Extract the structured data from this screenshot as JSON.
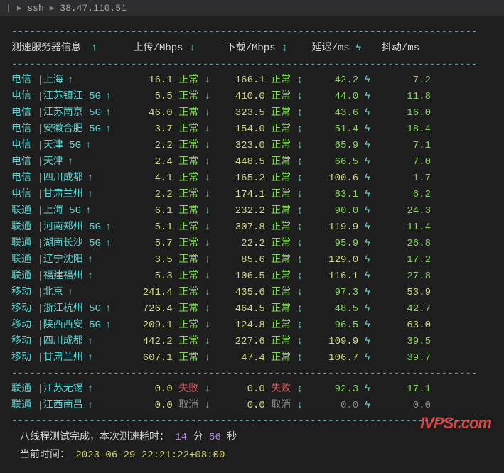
{
  "titlebar": {
    "ssh": "ssh",
    "ip": "38.47.110.51"
  },
  "headers": {
    "server": "测速服务器信息",
    "upload": "上传/Mbps",
    "download": "下载/Mbps",
    "latency": "延迟/ms",
    "jitter": "抖动/ms"
  },
  "rows": [
    {
      "isp": "电信",
      "loc": "上海",
      "up": "16.1",
      "up_st": "正常",
      "dn": "166.1",
      "dn_st": "正常",
      "lat": "42.2",
      "lat_c": "green",
      "jit": "7.2",
      "jit_c": "green"
    },
    {
      "isp": "电信",
      "loc": "江苏镇江 5G",
      "up": "5.5",
      "up_st": "正常",
      "dn": "410.0",
      "dn_st": "正常",
      "lat": "44.0",
      "lat_c": "green",
      "jit": "11.8",
      "jit_c": "green"
    },
    {
      "isp": "电信",
      "loc": "江苏南京 5G",
      "up": "46.0",
      "up_st": "正常",
      "dn": "323.5",
      "dn_st": "正常",
      "lat": "43.6",
      "lat_c": "green",
      "jit": "16.0",
      "jit_c": "green"
    },
    {
      "isp": "电信",
      "loc": "安徽合肥 5G",
      "up": "3.7",
      "up_st": "正常",
      "dn": "154.0",
      "dn_st": "正常",
      "lat": "51.4",
      "lat_c": "green",
      "jit": "18.4",
      "jit_c": "green"
    },
    {
      "isp": "电信",
      "loc": "天津 5G",
      "up": "2.2",
      "up_st": "正常",
      "dn": "323.0",
      "dn_st": "正常",
      "lat": "65.9",
      "lat_c": "green",
      "jit": "7.1",
      "jit_c": "green"
    },
    {
      "isp": "电信",
      "loc": "天津",
      "up": "2.4",
      "up_st": "正常",
      "dn": "448.5",
      "dn_st": "正常",
      "lat": "66.5",
      "lat_c": "green",
      "jit": "7.0",
      "jit_c": "green"
    },
    {
      "isp": "电信",
      "loc": "四川成都",
      "up": "4.1",
      "up_st": "正常",
      "dn": "165.2",
      "dn_st": "正常",
      "lat": "100.6",
      "lat_c": "yellow",
      "jit": "1.7",
      "jit_c": "green"
    },
    {
      "isp": "电信",
      "loc": "甘肃兰州",
      "up": "2.2",
      "up_st": "正常",
      "dn": "174.1",
      "dn_st": "正常",
      "lat": "83.1",
      "lat_c": "green",
      "jit": "6.2",
      "jit_c": "green"
    },
    {
      "isp": "联通",
      "loc": "上海 5G",
      "up": "6.1",
      "up_st": "正常",
      "dn": "232.2",
      "dn_st": "正常",
      "lat": "90.0",
      "lat_c": "green",
      "jit": "24.3",
      "jit_c": "green"
    },
    {
      "isp": "联通",
      "loc": "河南郑州 5G",
      "up": "5.1",
      "up_st": "正常",
      "dn": "307.8",
      "dn_st": "正常",
      "lat": "119.9",
      "lat_c": "yellow",
      "jit": "11.4",
      "jit_c": "green"
    },
    {
      "isp": "联通",
      "loc": "湖南长沙 5G",
      "up": "5.7",
      "up_st": "正常",
      "dn": "22.2",
      "dn_st": "正常",
      "lat": "95.9",
      "lat_c": "green",
      "jit": "26.8",
      "jit_c": "green"
    },
    {
      "isp": "联通",
      "loc": "辽宁沈阳",
      "up": "3.5",
      "up_st": "正常",
      "dn": "85.6",
      "dn_st": "正常",
      "lat": "129.0",
      "lat_c": "yellow",
      "jit": "17.2",
      "jit_c": "green"
    },
    {
      "isp": "联通",
      "loc": "福建福州",
      "up": "5.3",
      "up_st": "正常",
      "dn": "106.5",
      "dn_st": "正常",
      "lat": "116.1",
      "lat_c": "yellow",
      "jit": "27.8",
      "jit_c": "green"
    },
    {
      "isp": "移动",
      "loc": "北京",
      "up": "241.4",
      "up_st": "正常",
      "dn": "435.6",
      "dn_st": "正常",
      "lat": "97.3",
      "lat_c": "green",
      "jit": "53.9",
      "jit_c": "yellow"
    },
    {
      "isp": "移动",
      "loc": "浙江杭州 5G",
      "up": "726.4",
      "up_st": "正常",
      "dn": "464.5",
      "dn_st": "正常",
      "lat": "48.5",
      "lat_c": "green",
      "jit": "42.7",
      "jit_c": "green"
    },
    {
      "isp": "移动",
      "loc": "陕西西安 5G",
      "up": "209.1",
      "up_st": "正常",
      "dn": "124.8",
      "dn_st": "正常",
      "lat": "96.5",
      "lat_c": "green",
      "jit": "63.0",
      "jit_c": "yellow"
    },
    {
      "isp": "移动",
      "loc": "四川成都",
      "up": "442.2",
      "up_st": "正常",
      "dn": "227.6",
      "dn_st": "正常",
      "lat": "109.9",
      "lat_c": "yellow",
      "jit": "39.5",
      "jit_c": "green"
    },
    {
      "isp": "移动",
      "loc": "甘肃兰州",
      "up": "607.1",
      "up_st": "正常",
      "dn": "47.4",
      "dn_st": "正常",
      "lat": "106.7",
      "lat_c": "yellow",
      "jit": "39.7",
      "jit_c": "green"
    }
  ],
  "rows2": [
    {
      "isp": "联通",
      "loc": "江苏无锡",
      "up": "0.0",
      "up_st": "失败",
      "dn": "0.0",
      "dn_st": "失败",
      "lat": "92.3",
      "lat_c": "green",
      "jit": "17.1",
      "jit_c": "green"
    },
    {
      "isp": "联通",
      "loc": "江西南昌",
      "up": "0.0",
      "up_st": "取消",
      "dn": "0.0",
      "dn_st": "取消",
      "lat": "0.0",
      "lat_c": "grey",
      "jit": "0.0",
      "jit_c": "grey"
    }
  ],
  "footer": {
    "line1_prefix": "八线程测试完成，本次测速耗时：",
    "minutes": "14",
    "min_unit": "分",
    "seconds": "56",
    "sec_unit": "秒",
    "line2_prefix": "当前时间：",
    "timestamp": "2023-06-29 22:21:22+08:00"
  },
  "watermark": "IVPSr.com",
  "divider": "------------------------------------------------------------------------------"
}
